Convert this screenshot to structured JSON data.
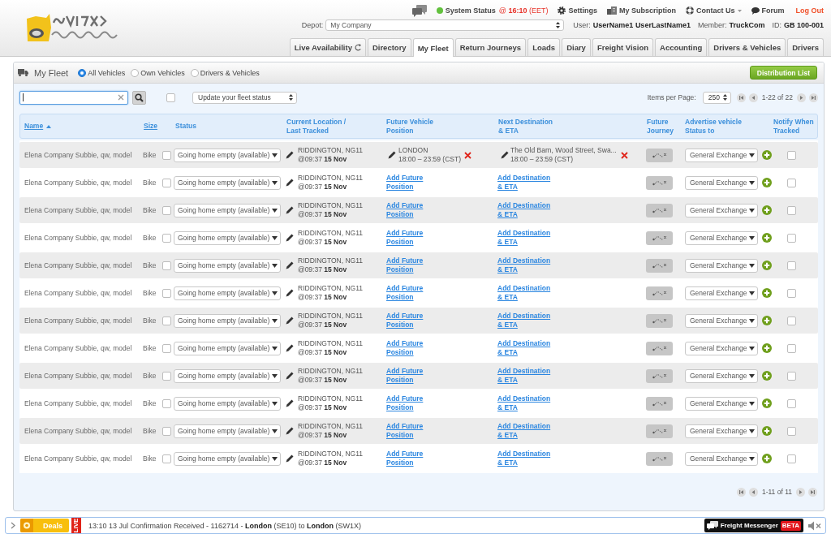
{
  "header": {
    "status": {
      "ok": true,
      "label": "System Status",
      "time": "@ **16:10** (EET)"
    },
    "links": [
      {
        "kind": "settings",
        "label": "Settings",
        "dropdown": false
      },
      {
        "kind": "subscription",
        "label": "My Subscription",
        "dropdown": false
      },
      {
        "kind": "contact",
        "label": "Contact Us",
        "dropdown": true
      },
      {
        "kind": "forum",
        "label": "Forum",
        "dropdown": false
      },
      {
        "kind": "logout",
        "label": "Log Out",
        "dropdown": false
      }
    ],
    "depot": {
      "label": "Depot:",
      "value": "My Company"
    },
    "account": [
      {
        "label": "User:",
        "value": "UserName1 UserLastName1"
      },
      {
        "label": "Member:",
        "value": "TruckCom"
      },
      {
        "label": "ID:",
        "value": "GB 100-001"
      }
    ],
    "tabs": [
      {
        "label": "Live Availability",
        "kind": "refresh",
        "selected": false
      },
      {
        "label": "Directory",
        "kind": "plain",
        "selected": false
      },
      {
        "label": "My Fleet",
        "kind": "plain",
        "selected": true
      },
      {
        "label": "Return Journeys",
        "kind": "plain",
        "selected": false
      },
      {
        "label": "Loads",
        "kind": "plain",
        "selected": false
      },
      {
        "label": "Diary",
        "kind": "plain",
        "selected": false
      },
      {
        "label": "Freight Vision",
        "kind": "plain",
        "selected": false
      },
      {
        "label": "Accounting",
        "kind": "plain",
        "selected": false
      },
      {
        "label": "Drivers & Vehicles",
        "kind": "plain",
        "selected": false
      },
      {
        "label": "Drivers",
        "kind": "plain",
        "selected": false
      }
    ]
  },
  "panel": {
    "title": "My Fleet",
    "filters": [
      {
        "label": "All Vehicles",
        "selected": true
      },
      {
        "label": "Own Vehicles",
        "selected": false
      },
      {
        "label": "Drivers & Vehicles",
        "selected": false
      }
    ],
    "action": "Distribution List"
  },
  "toolbar": {
    "select_all": {
      "checked": false
    },
    "bulk_status": "Update your fleet status",
    "per_page": {
      "label": "Items per Page:",
      "value": "250"
    },
    "range": "1-22 of 22"
  },
  "table": {
    "columns": [
      {
        "lines": [
          "Name"
        ],
        "link": true,
        "sorted": true
      },
      {
        "lines": [
          "Size"
        ],
        "link": true,
        "sorted": false
      },
      {
        "lines": [
          "Status"
        ],
        "link": false,
        "sorted": false
      },
      {
        "lines": [
          "Current Location /",
          "Last Tracked"
        ],
        "link": false,
        "sorted": false
      },
      {
        "lines": [
          "Future Vehicle",
          "Position"
        ],
        "link": false,
        "sorted": false
      },
      {
        "lines": [
          "Next Destination",
          "& ETA"
        ],
        "link": false,
        "sorted": false
      },
      {
        "lines": [
          "Future",
          "Journey"
        ],
        "link": false,
        "sorted": false
      },
      {
        "lines": [
          "Advertise vehicle",
          "Status to"
        ],
        "link": false,
        "sorted": false
      },
      {
        "lines": [
          "Notify When",
          "Tracked"
        ],
        "link": false,
        "sorted": false
      }
    ],
    "rows": [
      {
        "name": "Elena Company Subbie, qw, model",
        "size": "Bike",
        "checked": false,
        "status": "Going home empty (available)",
        "location": "RIDDINGTON, NG11",
        "tracked": "@09:37 **15 Nov**",
        "future": {
          "kind": "set",
          "place": "LONDON",
          "time": "18:00 – 23:59 (CST)"
        },
        "destination": {
          "kind": "set",
          "place": "The Old Barn, Wood Street, Swa...",
          "time": "18:00 – 23:59 (CST)"
        },
        "advertise": "General Exchange",
        "notify": false
      },
      {
        "name": "Elena Company Subbie, qw, model",
        "size": "Bike",
        "checked": false,
        "status": "Going home empty (available)",
        "location": "RIDDINGTON, NG11",
        "tracked": "@09:37 **15 Nov**",
        "future": {
          "kind": "link",
          "lines": [
            "Add Future",
            "Position"
          ]
        },
        "destination": {
          "kind": "link",
          "lines": [
            "Add Destination",
            "& ETA"
          ]
        },
        "advertise": "General Exchange",
        "notify": false
      },
      {
        "name": "Elena Company Subbie, qw, model",
        "size": "Bike",
        "checked": false,
        "status": "Going home empty (available)",
        "location": "RIDDINGTON, NG11",
        "tracked": "@09:37 **15 Nov**",
        "future": {
          "kind": "link",
          "lines": [
            "Add Future",
            "Position"
          ]
        },
        "destination": {
          "kind": "link",
          "lines": [
            "Add Destination",
            "& ETA"
          ]
        },
        "advertise": "General Exchange",
        "notify": false
      },
      {
        "name": "Elena Company Subbie, qw, model",
        "size": "Bike",
        "checked": false,
        "status": "Going home empty (available)",
        "location": "RIDDINGTON, NG11",
        "tracked": "@09:37 **15 Nov**",
        "future": {
          "kind": "link",
          "lines": [
            "Add Future",
            "Position"
          ]
        },
        "destination": {
          "kind": "link",
          "lines": [
            "Add Destination",
            "& ETA"
          ]
        },
        "advertise": "General Exchange",
        "notify": false
      },
      {
        "name": "Elena Company Subbie, qw, model",
        "size": "Bike",
        "checked": false,
        "status": "Going home empty (available)",
        "location": "RIDDINGTON, NG11",
        "tracked": "@09:37 **15 Nov**",
        "future": {
          "kind": "link",
          "lines": [
            "Add Future",
            "Position"
          ]
        },
        "destination": {
          "kind": "link",
          "lines": [
            "Add Destination",
            "& ETA"
          ]
        },
        "advertise": "General Exchange",
        "notify": false
      },
      {
        "name": "Elena Company Subbie, qw, model",
        "size": "Bike",
        "checked": false,
        "status": "Going home empty (available)",
        "location": "RIDDINGTON, NG11",
        "tracked": "@09:37 **15 Nov**",
        "future": {
          "kind": "link",
          "lines": [
            "Add Future",
            "Position"
          ]
        },
        "destination": {
          "kind": "link",
          "lines": [
            "Add Destination",
            "& ETA"
          ]
        },
        "advertise": "General Exchange",
        "notify": false
      },
      {
        "name": "Elena Company Subbie, qw, model",
        "size": "Bike",
        "checked": false,
        "status": "Going home empty (available)",
        "location": "RIDDINGTON, NG11",
        "tracked": "@09:37 **15 Nov**",
        "future": {
          "kind": "link",
          "lines": [
            "Add Future",
            "Position"
          ]
        },
        "destination": {
          "kind": "link",
          "lines": [
            "Add Destination",
            "& ETA"
          ]
        },
        "advertise": "General Exchange",
        "notify": false
      },
      {
        "name": "Elena Company Subbie, qw, model",
        "size": "Bike",
        "checked": false,
        "status": "Going home empty (available)",
        "location": "RIDDINGTON, NG11",
        "tracked": "@09:37 **15 Nov**",
        "future": {
          "kind": "link",
          "lines": [
            "Add Future",
            "Position"
          ]
        },
        "destination": {
          "kind": "link",
          "lines": [
            "Add Destination",
            "& ETA"
          ]
        },
        "advertise": "General Exchange",
        "notify": false
      },
      {
        "name": "Elena Company Subbie, qw, model",
        "size": "Bike",
        "checked": false,
        "status": "Going home empty (available)",
        "location": "RIDDINGTON, NG11",
        "tracked": "@09:37 **15 Nov**",
        "future": {
          "kind": "link",
          "lines": [
            "Add Future",
            "Position"
          ]
        },
        "destination": {
          "kind": "link",
          "lines": [
            "Add Destination",
            "& ETA"
          ]
        },
        "advertise": "General Exchange",
        "notify": false
      },
      {
        "name": "Elena Company Subbie, qw, model",
        "size": "Bike",
        "checked": false,
        "status": "Going home empty (available)",
        "location": "RIDDINGTON, NG11",
        "tracked": "@09:37 **15 Nov**",
        "future": {
          "kind": "link",
          "lines": [
            "Add Future",
            "Position"
          ]
        },
        "destination": {
          "kind": "link",
          "lines": [
            "Add Destination",
            "& ETA"
          ]
        },
        "advertise": "General Exchange",
        "notify": false
      },
      {
        "name": "Elena Company Subbie, qw, model",
        "size": "Bike",
        "checked": false,
        "status": "Going home empty (available)",
        "location": "RIDDINGTON, NG11",
        "tracked": "@09:37 **15 Nov**",
        "future": {
          "kind": "link",
          "lines": [
            "Add Future",
            "Position"
          ]
        },
        "destination": {
          "kind": "link",
          "lines": [
            "Add Destination",
            "& ETA"
          ]
        },
        "advertise": "General Exchange",
        "notify": false
      },
      {
        "name": "Elena Company Subbie, qw, model",
        "size": "Bike",
        "checked": false,
        "status": "Going home empty (available)",
        "location": "RIDDINGTON, NG11",
        "tracked": "@09:37 **15 Nov**",
        "future": {
          "kind": "link",
          "lines": [
            "Add Future",
            "Position"
          ]
        },
        "destination": {
          "kind": "link",
          "lines": [
            "Add Destination",
            "& ETA"
          ]
        },
        "advertise": "General Exchange",
        "notify": false
      }
    ]
  },
  "footer": {
    "range": "1-11 of 11"
  },
  "ticker": {
    "deals": "Deals",
    "live": "LIVE",
    "message": "13:10 13 Jul Confirmation Received - 1162714 - **London** (SE10) to **London** (SW1X)",
    "messenger": "Freight Messenger",
    "badge": "BETA",
    "muted": true
  }
}
